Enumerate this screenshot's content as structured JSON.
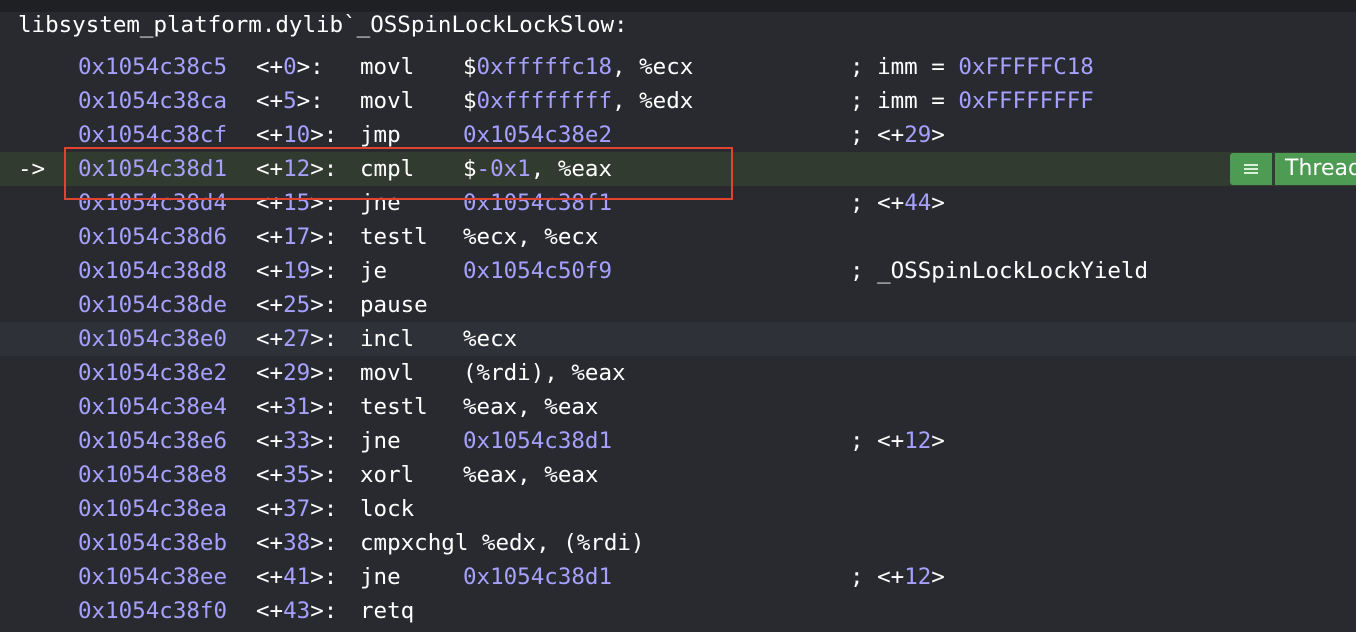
{
  "function_header": "libsystem_platform.dylib`_OSSpinLockLockSlow:",
  "pc_arrow": "->",
  "thread_badge": {
    "label": "Thread"
  },
  "colors": {
    "background": "#292a30",
    "address": "#a6a0ff",
    "current_line_bg": "#323b2f",
    "highlight_border": "#e0432f",
    "badge_green": "#4e9b53"
  },
  "lines": [
    {
      "addr": "0x1054c38c5",
      "off_pre": "<+",
      "off_num": "0",
      "off_post": ">:",
      "mnem": "movl",
      "op_pre": "$",
      "op_num": "0xfffffc18",
      "op_post": ", %ecx",
      "cmt_pre": "; imm = ",
      "cmt_num": "0xFFFFFC18",
      "cmt_post": ""
    },
    {
      "addr": "0x1054c38ca",
      "off_pre": "<+",
      "off_num": "5",
      "off_post": ">:",
      "mnem": "movl",
      "op_pre": "$",
      "op_num": "0xffffffff",
      "op_post": ", %edx",
      "cmt_pre": "; imm = ",
      "cmt_num": "0xFFFFFFFF",
      "cmt_post": ""
    },
    {
      "addr": "0x1054c38cf",
      "off_pre": "<+",
      "off_num": "10",
      "off_post": ">:",
      "mnem": "jmp",
      "op_pre": "",
      "op_num": "0x1054c38e2",
      "op_post": "",
      "cmt_pre": "; <+",
      "cmt_num": "29",
      "cmt_post": ">"
    },
    {
      "addr": "0x1054c38d1",
      "off_pre": "<+",
      "off_num": "12",
      "off_post": ">:",
      "mnem": "cmpl",
      "op_pre": "$",
      "op_num": "-0x1",
      "op_post": ", %eax",
      "cmt_pre": "",
      "cmt_num": "",
      "cmt_post": ""
    },
    {
      "addr": "0x1054c38d4",
      "off_pre": "<+",
      "off_num": "15",
      "off_post": ">:",
      "mnem": "jne",
      "op_pre": "",
      "op_num": "0x1054c38f1",
      "op_post": "",
      "cmt_pre": "; <+",
      "cmt_num": "44",
      "cmt_post": ">"
    },
    {
      "addr": "0x1054c38d6",
      "off_pre": "<+",
      "off_num": "17",
      "off_post": ">:",
      "mnem": "testl",
      "op_pre": "%ecx, %ecx",
      "op_num": "",
      "op_post": "",
      "cmt_pre": "",
      "cmt_num": "",
      "cmt_post": ""
    },
    {
      "addr": "0x1054c38d8",
      "off_pre": "<+",
      "off_num": "19",
      "off_post": ">:",
      "mnem": "je",
      "op_pre": "",
      "op_num": "0x1054c50f9",
      "op_post": "",
      "cmt_pre": "; _OSSpinLockLockYield",
      "cmt_num": "",
      "cmt_post": ""
    },
    {
      "addr": "0x1054c38de",
      "off_pre": "<+",
      "off_num": "25",
      "off_post": ">:",
      "mnem": "pause",
      "op_pre": "",
      "op_num": "",
      "op_post": "",
      "cmt_pre": "",
      "cmt_num": "",
      "cmt_post": ""
    },
    {
      "addr": "0x1054c38e0",
      "off_pre": "<+",
      "off_num": "27",
      "off_post": ">:",
      "mnem": "incl",
      "op_pre": "%ecx",
      "op_num": "",
      "op_post": "",
      "cmt_pre": "",
      "cmt_num": "",
      "cmt_post": ""
    },
    {
      "addr": "0x1054c38e2",
      "off_pre": "<+",
      "off_num": "29",
      "off_post": ">:",
      "mnem": "movl",
      "op_pre": "(%rdi), %eax",
      "op_num": "",
      "op_post": "",
      "cmt_pre": "",
      "cmt_num": "",
      "cmt_post": ""
    },
    {
      "addr": "0x1054c38e4",
      "off_pre": "<+",
      "off_num": "31",
      "off_post": ">:",
      "mnem": "testl",
      "op_pre": "%eax, %eax",
      "op_num": "",
      "op_post": "",
      "cmt_pre": "",
      "cmt_num": "",
      "cmt_post": ""
    },
    {
      "addr": "0x1054c38e6",
      "off_pre": "<+",
      "off_num": "33",
      "off_post": ">:",
      "mnem": "jne",
      "op_pre": "",
      "op_num": "0x1054c38d1",
      "op_post": "",
      "cmt_pre": "; <+",
      "cmt_num": "12",
      "cmt_post": ">"
    },
    {
      "addr": "0x1054c38e8",
      "off_pre": "<+",
      "off_num": "35",
      "off_post": ">:",
      "mnem": "xorl",
      "op_pre": "%eax, %eax",
      "op_num": "",
      "op_post": "",
      "cmt_pre": "",
      "cmt_num": "",
      "cmt_post": ""
    },
    {
      "addr": "0x1054c38ea",
      "off_pre": "<+",
      "off_num": "37",
      "off_post": ">:",
      "mnem": "lock",
      "op_pre": "",
      "op_num": "",
      "op_post": "",
      "cmt_pre": "",
      "cmt_num": "",
      "cmt_post": ""
    },
    {
      "addr": "0x1054c38eb",
      "off_pre": "<+",
      "off_num": "38",
      "off_post": ">:",
      "mnem": "cmpxchgl %edx, (%rdi)",
      "op_pre": "",
      "op_num": "",
      "op_post": "",
      "cmt_pre": "",
      "cmt_num": "",
      "cmt_post": ""
    },
    {
      "addr": "0x1054c38ee",
      "off_pre": "<+",
      "off_num": "41",
      "off_post": ">:",
      "mnem": "jne",
      "op_pre": "",
      "op_num": "0x1054c38d1",
      "op_post": "",
      "cmt_pre": "; <+",
      "cmt_num": "12",
      "cmt_post": ">"
    },
    {
      "addr": "0x1054c38f0",
      "off_pre": "<+",
      "off_num": "43",
      "off_post": ">:",
      "mnem": "retq",
      "op_pre": "",
      "op_num": "",
      "op_post": "",
      "cmt_pre": "",
      "cmt_num": "",
      "cmt_post": ""
    }
  ]
}
